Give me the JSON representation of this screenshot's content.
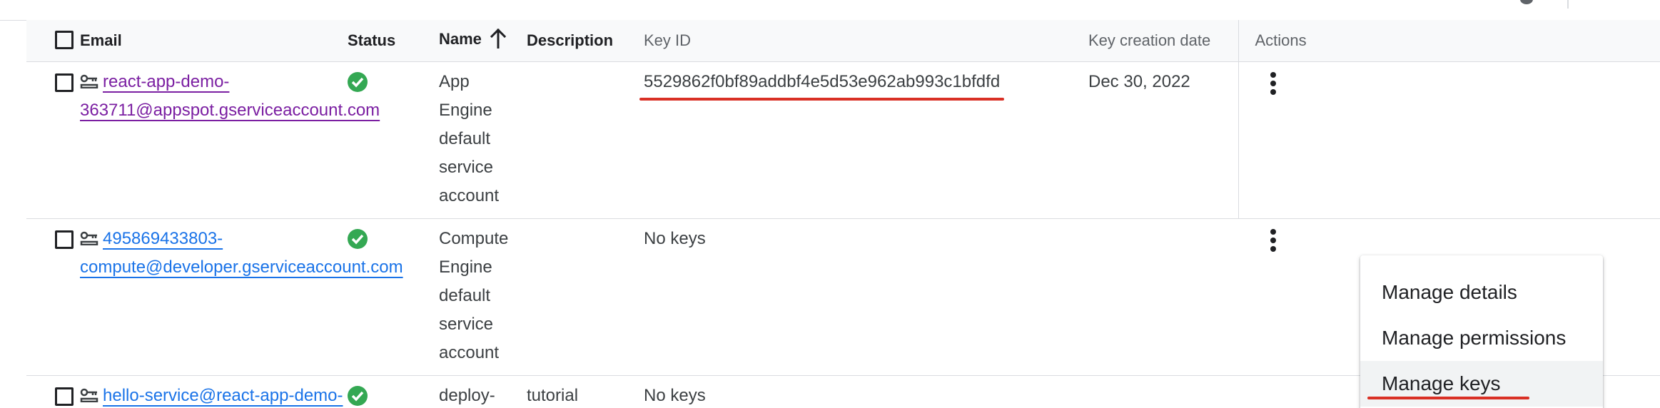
{
  "table": {
    "headers": {
      "email": "Email",
      "status": "Status",
      "name": "Name",
      "description": "Description",
      "key_id": "Key ID",
      "key_creation_date": "Key creation date",
      "actions": "Actions"
    },
    "sort": {
      "column": "name",
      "direction": "ascending",
      "icon": "arrow-up-icon"
    },
    "rows": [
      {
        "email_line1": "react-app-demo-",
        "email_line2": "363711@appspot.gserviceaccount.com",
        "status_icon": "check-circle-icon",
        "status_color": "#34a853",
        "name_lines": [
          "App",
          "Engine",
          "default",
          "service",
          "account"
        ],
        "description": "",
        "key_id": "5529862f0bf89addbf4e5d53e962ab993c1bfdfd",
        "key_creation_date": "Dec 30, 2022",
        "link_color": "#7b1fa2"
      },
      {
        "email_line1": "495869433803-",
        "email_line2": "compute@developer.gserviceaccount.com",
        "status_icon": "check-circle-icon",
        "status_color": "#34a853",
        "name_lines": [
          "Compute",
          "Engine",
          "default",
          "service",
          "account"
        ],
        "description": "",
        "key_id": "No keys",
        "key_creation_date": "",
        "link_color": "#1a73e8"
      },
      {
        "email_line1": "hello-service@react-app-demo-",
        "email_line2": "",
        "status_icon": "check-circle-icon",
        "status_color": "#34a853",
        "name_lines": [
          "deploy-"
        ],
        "description": "tutorial",
        "key_id": "No keys",
        "key_creation_date": "",
        "link_color": "#1a73e8"
      }
    ]
  },
  "actions_menu": {
    "items": [
      {
        "label": "Manage details"
      },
      {
        "label": "Manage permissions"
      },
      {
        "label": "Manage keys",
        "highlighted": true
      }
    ]
  },
  "annotation_color": "#d93025"
}
